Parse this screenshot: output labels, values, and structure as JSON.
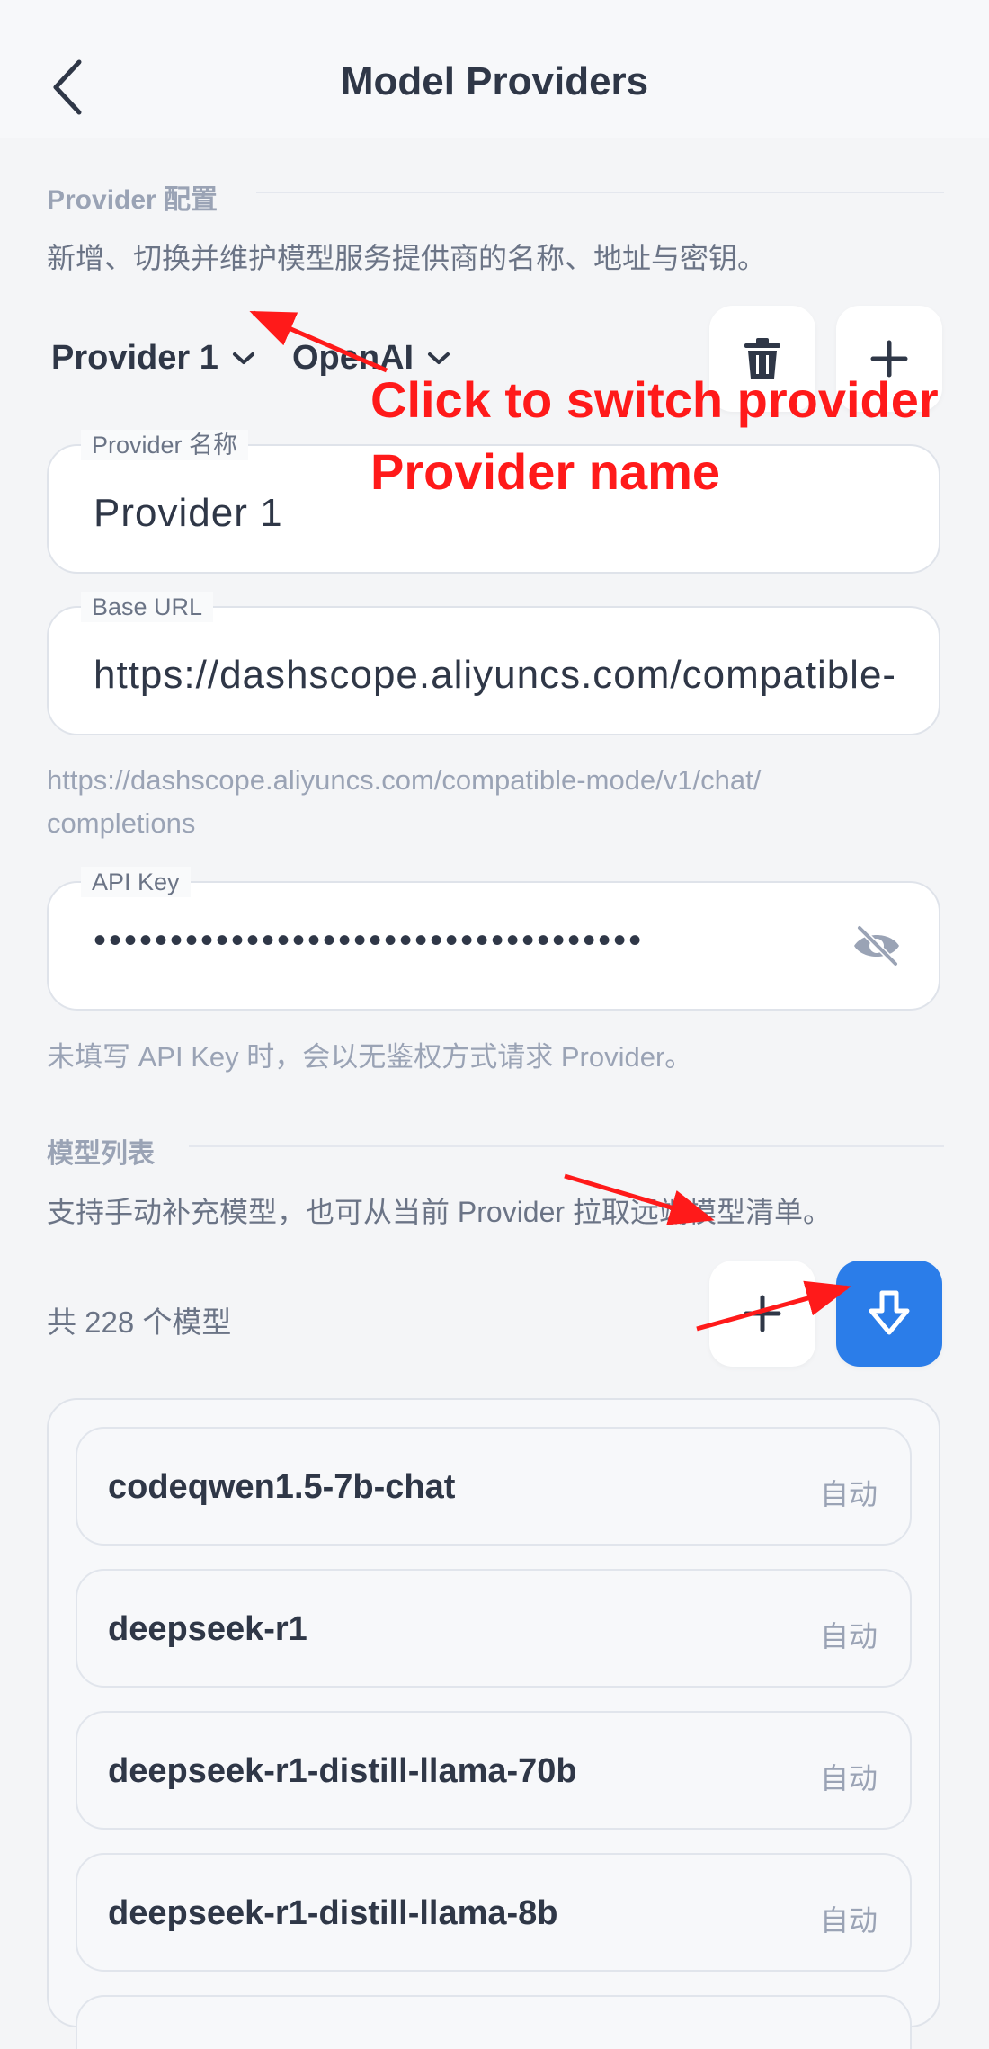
{
  "header": {
    "title": "Model Providers"
  },
  "provider_section": {
    "title": "Provider 配置",
    "description": "新增、切换并维护模型服务提供商的名称、地址与密钥。",
    "provider_select": "Provider 1",
    "type_select": "OpenAI"
  },
  "fields": {
    "name": {
      "label": "Provider 名称",
      "value": "Provider 1"
    },
    "base_url": {
      "label": "Base URL",
      "value": "https://dashscope.aliyuncs.com/compatible-mode/v1"
    },
    "base_url_hint_line1": "https://dashscope.aliyuncs.com/compatible-mode/v1/chat/",
    "base_url_hint_line2": "completions",
    "api_key": {
      "label": "API Key",
      "value": "••••••••••••••••••••••••••••••••••••"
    },
    "api_key_hint": "未填写 API Key 时，会以无鉴权方式请求 Provider。"
  },
  "models_section": {
    "title": "模型列表",
    "description": "支持手动补充模型，也可从当前 Provider 拉取远端模型清单。",
    "count_text": "共 228 个模型",
    "items": [
      {
        "name": "codeqwen1.5-7b-chat",
        "tag": "自动"
      },
      {
        "name": "deepseek-r1",
        "tag": "自动"
      },
      {
        "name": "deepseek-r1-distill-llama-70b",
        "tag": "自动"
      },
      {
        "name": "deepseek-r1-distill-llama-8b",
        "tag": "自动"
      }
    ]
  },
  "annotations": {
    "line1": "Click to switch provider",
    "line2": "Provider name"
  },
  "colors": {
    "accent": "#2b7de9",
    "annotation": "#ff1a1a"
  }
}
